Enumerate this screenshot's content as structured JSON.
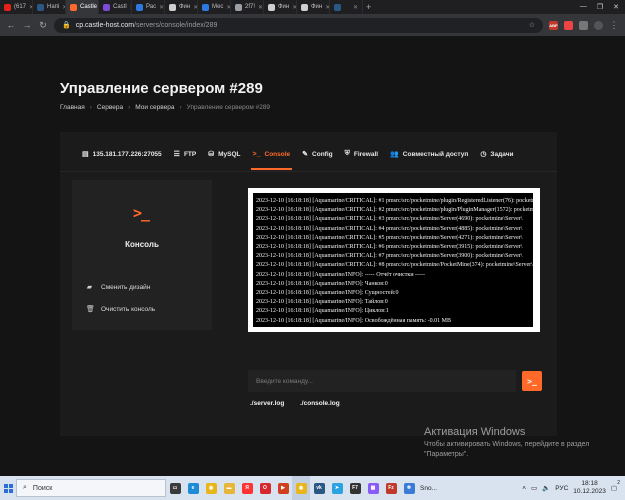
{
  "browser": {
    "tabs": [
      {
        "label": "(617",
        "color": "#e62117"
      },
      {
        "label": "Напі",
        "color": "#2a5885"
      },
      {
        "label": "Castle",
        "color": "#ff6a2b",
        "active": true
      },
      {
        "label": "Castl",
        "color": "#7b4bd6"
      },
      {
        "label": "Рас",
        "color": "#2a7ae2"
      },
      {
        "label": "Фин",
        "color": "#cfcfcf"
      },
      {
        "label": "Мес",
        "color": "#2a7ae2"
      },
      {
        "label": "2f7!",
        "color": "#9aa0a6"
      },
      {
        "label": "Фин",
        "color": "#cfcfcf"
      },
      {
        "label": "Фин",
        "color": "#cfcfcf"
      },
      {
        "label": "",
        "color": "#2a5885"
      }
    ],
    "new_tab": "+",
    "url_host": "cp.castle-host.com",
    "url_path": "/servers/console/index/289"
  },
  "page": {
    "title": "Управление сервером #289",
    "breadcrumb": [
      "Главная",
      "Сервера",
      "Мои сервера",
      "Управление сервером #289"
    ],
    "tabs": [
      {
        "icon": "server-icon",
        "glyph": "▤",
        "label": "135.181.177.226:27055"
      },
      {
        "icon": "ftp-icon",
        "glyph": "☰",
        "label": "FTP"
      },
      {
        "icon": "database-icon",
        "glyph": "⛁",
        "label": "MySQL"
      },
      {
        "icon": "terminal-icon",
        "glyph": ">_",
        "label": "Console",
        "active": true
      },
      {
        "icon": "wrench-icon",
        "glyph": "✎",
        "label": "Config"
      },
      {
        "icon": "firewall-icon",
        "glyph": "⛨",
        "label": "Firewall"
      },
      {
        "icon": "users-icon",
        "glyph": "👥",
        "label": "Совместный доступ"
      },
      {
        "icon": "clock-icon",
        "glyph": "◷",
        "label": "Задачи"
      }
    ],
    "panel": {
      "icon_glyph": ">_",
      "title": "Консоль",
      "items": [
        {
          "icon": "paint-icon",
          "glyph": "▰",
          "label": "Сменить дизайн"
        },
        {
          "icon": "trash-icon",
          "glyph": "🗑",
          "label": "Очистить консоль"
        }
      ]
    },
    "console_lines": [
      "2023-12-10 [16:18:18] [Aquamarine/CRITICAL]: #1 pmsrc/src/pocketmine/plugin/RegisteredListener(76): pocketmine\\plugin\\",
      "2023-12-10 [16:18:18] [Aquamarine/CRITICAL]: #2 pmsrc/src/pocketmine/plugin/PluginManager(1572): pocketmine\\plugin\\",
      "2023-12-10 [16:18:18] [Aquamarine/CRITICAL]: #3 pmsrc/src/pocketmine/Server(4690): pocketmine\\Server\\",
      "2023-12-10 [16:18:18] [Aquamarine/CRITICAL]: #4 pmsrc/src/pocketmine/Server(4885): pocketmine\\Server\\",
      "2023-12-10 [16:18:18] [Aquamarine/CRITICAL]: #5 pmsrc/src/pocketmine/Server(4271): pocketmine\\Server\\",
      "2023-12-10 [16:18:18] [Aquamarine/CRITICAL]: #6 pmsrc/src/pocketmine/Server(3915): pocketmine\\Server\\",
      "2023-12-10 [16:18:18] [Aquamarine/CRITICAL]: #7 pmsrc/src/pocketmine/Server(3900): pocketmine\\Server\\",
      "2023-12-10 [16:18:18] [Aquamarine/CRITICAL]: #8 pmsrc/src/pocketmine/PocketMine(374): pocketmine\\Server\\",
      "2023-12-10 [16:18:18] [Aquamarine/INFO]: ----- Отчёт очистки -----",
      "2023-12-10 [16:18:18] [Aquamarine/INFO]: Чанков:0",
      "2023-12-10 [16:18:18] [Aquamarine/INFO]: Сущностей:0",
      "2023-12-10 [16:18:18] [Aquamarine/INFO]: Тайлов:0",
      "2023-12-10 [16:18:18] [Aquamarine/INFO]: Циклов:1",
      "2023-12-10 [16:18:18] [Aquamarine/INFO]: Освобождённая память: -0.01 MB"
    ],
    "command_placeholder": "Введите команду...",
    "send_glyph": ">_",
    "links": [
      "./server.log",
      "./console.log"
    ]
  },
  "activation": {
    "heading": "Активация Windows",
    "text": "Чтобы активировать Windows, перейдите в раздел \"Параметры\"."
  },
  "taskbar": {
    "search_placeholder": "Поиск",
    "apps": [
      {
        "icon": "task-view-icon",
        "color": "#3a3a3a",
        "glyph": "▭"
      },
      {
        "icon": "edge-icon",
        "color": "#1f8ad6",
        "glyph": "e"
      },
      {
        "icon": "chrome-icon",
        "color": "#e8b51a",
        "glyph": "◉"
      },
      {
        "icon": "explorer-icon",
        "color": "#e6b63a",
        "glyph": "▬"
      },
      {
        "icon": "yandex-icon",
        "color": "#ff3333",
        "glyph": "Я"
      },
      {
        "icon": "opera-icon",
        "color": "#d8282f",
        "glyph": "O"
      },
      {
        "icon": "app-icon",
        "color": "#d04020",
        "glyph": "▶"
      },
      {
        "icon": "chrome-active-icon",
        "color": "#e8b51a",
        "glyph": "◉",
        "active": true
      },
      {
        "icon": "vk-icon",
        "color": "#2a5885",
        "glyph": "vk"
      },
      {
        "icon": "telegram-icon",
        "color": "#2aa3e0",
        "glyph": "➤"
      },
      {
        "icon": "f7-icon",
        "color": "#333",
        "glyph": "F7"
      },
      {
        "icon": "store-icon",
        "color": "#8a5cf5",
        "glyph": "▦"
      },
      {
        "icon": "filezilla-icon",
        "color": "#c0392b",
        "glyph": "Fz"
      },
      {
        "icon": "snow-icon",
        "color": "#3a7bd5",
        "glyph": "❄"
      }
    ],
    "snow_label": "Sno...",
    "lang": "РУС",
    "time": "18:18",
    "date": "10.12.2023",
    "notify_count": "2"
  }
}
